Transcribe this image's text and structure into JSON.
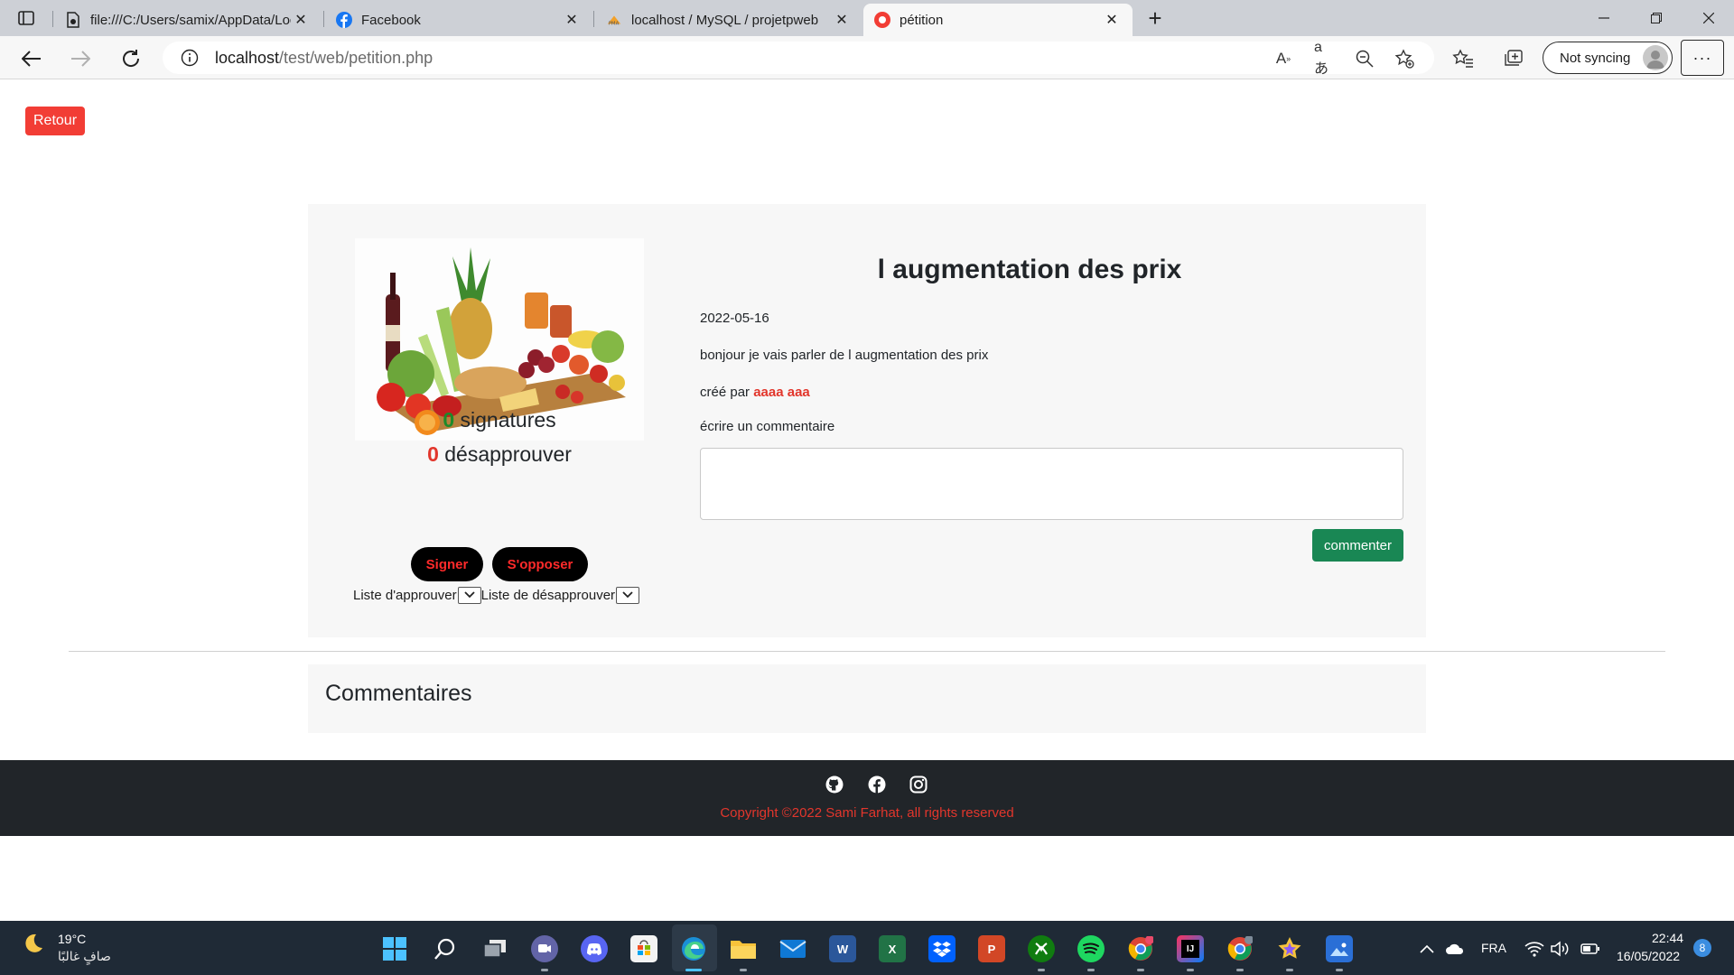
{
  "browser": {
    "tabs": [
      {
        "title": "file:///C:/Users/samix/AppData/Local",
        "favicon": "file-icon",
        "active": false
      },
      {
        "title": "Facebook",
        "favicon": "facebook-icon",
        "active": false
      },
      {
        "title": "localhost / MySQL / projetpweb",
        "favicon": "phpmyadmin-icon",
        "active": false
      },
      {
        "title": "pétition",
        "favicon": "petition-site-icon",
        "active": true
      }
    ],
    "address": {
      "host": "localhost",
      "path": "/test/web/petition.php"
    },
    "sync_label": "Not syncing"
  },
  "page": {
    "back_label": "Retour",
    "petition": {
      "title": "l augmentation des prix",
      "date": "2022-05-16",
      "description": "bonjour je vais parler de l augmentation des prix",
      "created_by_label": "créé par",
      "author": "aaaa aaa",
      "comment_prompt": "écrire un commentaire",
      "comment_value": "",
      "comment_button": "commenter",
      "image_alt": "photo de fruits et légumes"
    },
    "signatures": {
      "count": "0",
      "label": "signatures"
    },
    "disapprovals": {
      "count": "0",
      "label": "désapprouver"
    },
    "sign_button": "Signer",
    "oppose_button": "S'opposer",
    "approve_list_label": "Liste d'approuver",
    "disapprove_list_label": "Liste de désapprouver",
    "comments_title": "Commentaires",
    "footer": {
      "social": [
        "github-icon",
        "facebook-icon",
        "instagram-icon"
      ],
      "copyright": "Copyright ©2022 Sami Farhat, all rights reserved"
    }
  },
  "colors": {
    "danger": "#e2362c",
    "success": "#198754",
    "footer_bg": "#212529",
    "card_bg": "#f7f7f7"
  },
  "taskbar": {
    "weather": {
      "temp": "19°C",
      "condition": "صافٍ غالبًا"
    },
    "apps": [
      "windows-start-icon",
      "search-icon",
      "task-view-icon",
      "teams-chat-icon",
      "discord-icon",
      "microsoft-store-icon",
      "edge-icon",
      "file-explorer-icon",
      "mail-icon",
      "word-icon",
      "excel-icon",
      "dropbox-icon",
      "powerpoint-icon",
      "xbox-icon",
      "spotify-icon",
      "chrome-icon",
      "intellij-icon",
      "chrome-profile-icon",
      "star-app-icon",
      "photos-icon"
    ],
    "language": "FRA",
    "time": "22:44",
    "date": "16/05/2022",
    "notifications": "8"
  }
}
